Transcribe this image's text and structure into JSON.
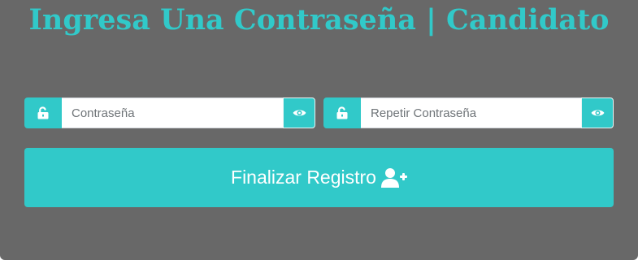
{
  "title": "Ingresa Una Contraseña | Candidato",
  "password": {
    "placeholder": "Contraseña",
    "value": "",
    "lock_icon": "unlock-icon",
    "toggle_icon": "eye-icon"
  },
  "password_repeat": {
    "placeholder": "Repetir Contraseña",
    "value": "",
    "lock_icon": "unlock-icon",
    "toggle_icon": "eye-icon"
  },
  "submit": {
    "label": "Finalizar Registro",
    "icon": "user-plus-icon"
  },
  "colors": {
    "background": "#686868",
    "accent": "#31c9c9",
    "text_on_accent": "#ffffff"
  }
}
